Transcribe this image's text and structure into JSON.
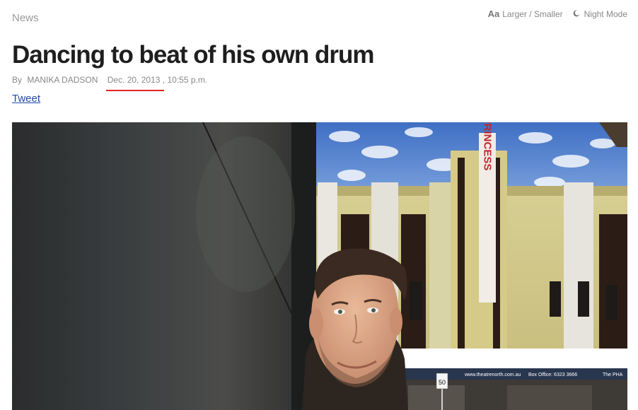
{
  "section": "News",
  "tools": {
    "font_size_icon": "Aa",
    "font_size_label": "Larger / Smaller",
    "night_mode_icon": "moon-icon",
    "night_mode_label": "Night Mode"
  },
  "article": {
    "headline": "Dancing to beat of his own drum",
    "byline_prefix": "By",
    "author": "MANIKA DADSON",
    "date": "Dec. 20, 2013",
    "time": ", 10:55 p.m.",
    "tweet_label": "Tweet"
  },
  "photo": {
    "vertical_sign_text": "PRINCESS",
    "banner_site": "www.theatrenorth.com.au",
    "banner_box_office": "Box Office: 6323 3666",
    "banner_right": "The PHA",
    "speed_sign": "50"
  },
  "colors": {
    "headline": "#1e1e1e",
    "link": "#1f4aa8",
    "date_underline": "#e0251f"
  }
}
